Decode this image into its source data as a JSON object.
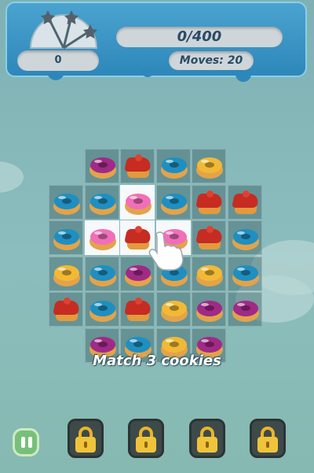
{
  "header": {
    "score": "0",
    "goal": "0/400",
    "moves": "Moves: 20",
    "stars_earned": 0,
    "stars_total": 3
  },
  "board": {
    "rows": [
      [
        null,
        "purple-donut",
        "red-cake",
        "blue-donut",
        "yellow-donut",
        null
      ],
      [
        "blue-donut",
        "blue-donut",
        "pink-donut",
        "blue-donut",
        "red-cake",
        "red-cake"
      ],
      [
        "blue-donut",
        "pink-donut",
        "red-cake",
        "pink-donut",
        "red-cake",
        "blue-donut"
      ],
      [
        "yellow-donut",
        "blue-donut",
        "purple-donut",
        "blue-donut",
        "yellow-donut",
        "blue-donut"
      ],
      [
        "red-cake",
        "blue-donut",
        "red-cake",
        "yellow-donut",
        "purple-donut",
        "purple-donut"
      ],
      [
        null,
        "purple-donut",
        "blue-donut",
        "yellow-donut",
        "purple-donut",
        null
      ]
    ],
    "highlighted": [
      [
        1,
        2
      ],
      [
        2,
        1
      ],
      [
        2,
        2
      ],
      [
        2,
        3
      ]
    ]
  },
  "tutorial": {
    "hint": "Match 3 cookies"
  },
  "boosters": {
    "slots": [
      "locked",
      "locked",
      "locked",
      "locked"
    ]
  },
  "colors": {
    "pink-donut": "#f06fb8",
    "purple-donut": "#a02a86",
    "blue-donut": "#1f8fc1",
    "yellow-donut": "#f2b936"
  }
}
